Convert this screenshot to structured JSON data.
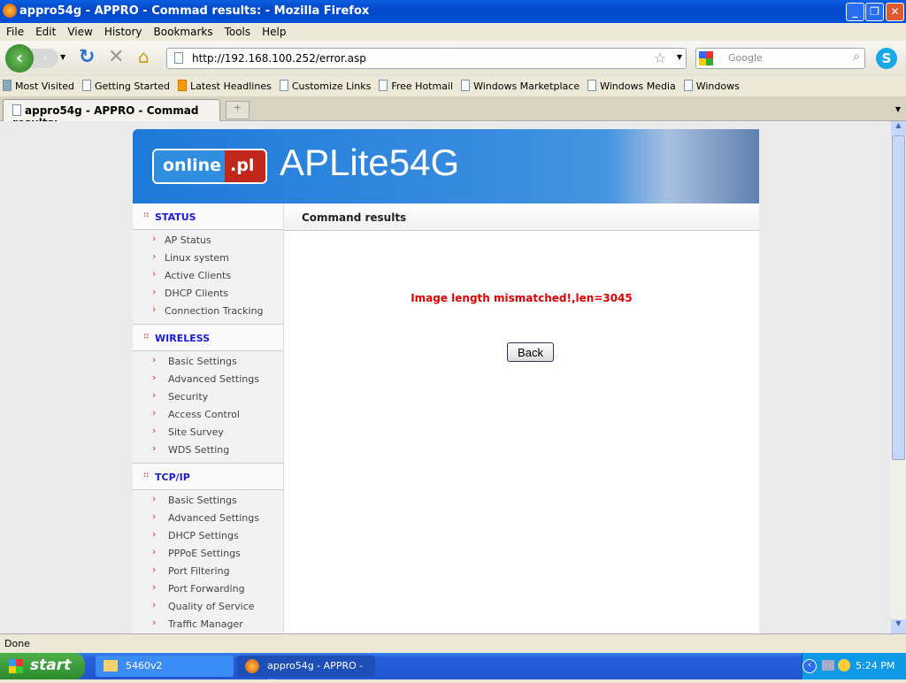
{
  "window": {
    "title": "appro54g - APPRO - Commad results: - Mozilla Firefox"
  },
  "menu": [
    "File",
    "Edit",
    "View",
    "History",
    "Bookmarks",
    "Tools",
    "Help"
  ],
  "nav": {
    "url": "http://192.168.100.252/error.asp",
    "search_placeholder": "Google"
  },
  "bookmarks": [
    "Most Visited",
    "Getting Started",
    "Latest Headlines",
    "Customize Links",
    "Free Hotmail",
    "Windows Marketplace",
    "Windows Media",
    "Windows"
  ],
  "tab": {
    "label": "appro54g - APPRO - Commad results:",
    "new_tab": "+"
  },
  "banner": {
    "logo_left": "online",
    "logo_right": ".pl",
    "product": "APLite54G"
  },
  "sidebar": [
    {
      "title": "STATUS",
      "items": [
        "AP Status",
        "Linux system",
        "Active Clients",
        "DHCP Clients",
        "Connection Tracking"
      ]
    },
    {
      "title": "WIRELESS",
      "items": [
        "Basic Settings",
        "Advanced Settings",
        "Security",
        "Access Control",
        "Site Survey",
        "WDS Setting"
      ]
    },
    {
      "title": "TCP/IP",
      "items": [
        "Basic Settings",
        "Advanced Settings",
        "DHCP Settings",
        "PPPoE Settings",
        "Port Filtering",
        "Port Forwarding",
        "Quality of Service",
        "Traffic Manager"
      ]
    },
    {
      "title": "OTHER",
      "items": []
    }
  ],
  "main": {
    "header": "Command results",
    "error": "Image length mismatched!,len=3045",
    "back_label": "Back"
  },
  "statusbar": "Done",
  "taskbar": {
    "start": "start",
    "items": [
      "5460v2",
      "appro54g - APPRO - ..."
    ],
    "clock": "5:24 PM"
  }
}
